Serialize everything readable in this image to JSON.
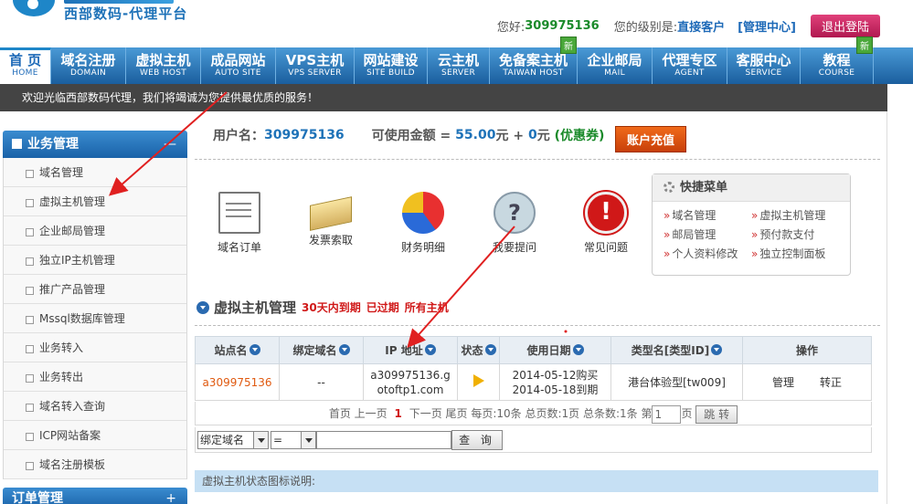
{
  "header": {
    "logo_text": "西部数码-代理平台",
    "greeting_label": "您好:",
    "user_id": "309975136",
    "level_label": "您的级别是:",
    "level_value": "直接客户",
    "manage_link": "[管理中心]",
    "logout_label": "退出登陆"
  },
  "nav": {
    "items": [
      {
        "cn": "首 页",
        "en": "HOME"
      },
      {
        "cn": "域名注册",
        "en": "DOMAIN"
      },
      {
        "cn": "虚拟主机",
        "en": "WEB HOST"
      },
      {
        "cn": "成品网站",
        "en": "AUTO SITE"
      },
      {
        "cn": "VPS主机",
        "en": "VPS SERVER"
      },
      {
        "cn": "网站建设",
        "en": "SITE BUILD"
      },
      {
        "cn": "云主机",
        "en": "SERVER"
      },
      {
        "cn": "免备案主机",
        "en": "TAIWAN HOST"
      },
      {
        "cn": "企业邮局",
        "en": "MAIL"
      },
      {
        "cn": "代理专区",
        "en": "AGENT"
      },
      {
        "cn": "客服中心",
        "en": "SERVICE"
      },
      {
        "cn": "教程",
        "en": "COURSE"
      }
    ],
    "new_badge": "新"
  },
  "welcome": "欢迎光临西部数码代理，我们将竭诚为您提供最优质的服务！",
  "sidebar": {
    "section_title": "业务管理",
    "section_toggle": "—",
    "items": [
      {
        "label": "域名管理"
      },
      {
        "label": "虚拟主机管理"
      },
      {
        "label": "企业邮局管理"
      },
      {
        "label": "独立IP主机管理"
      },
      {
        "label": "推广产品管理"
      },
      {
        "label": "Mssql数据库管理"
      },
      {
        "label": "业务转入"
      },
      {
        "label": "业务转出"
      },
      {
        "label": "域名转入查询"
      },
      {
        "label": "ICP网站备案"
      },
      {
        "label": "域名注册模板"
      }
    ],
    "section2_title": "订单管理",
    "section2_toggle": "+"
  },
  "account": {
    "username_label": "用户名：",
    "username": "309975136",
    "balance_label": "可使用金额 =",
    "balance": "55.00",
    "unit1": "元 +",
    "coupon_amount": "0",
    "unit2": "元",
    "coupon_label": "(优惠券)",
    "recharge_label": "账户充值"
  },
  "quick_icons": [
    {
      "label": "域名订单",
      "icon": "order-icon"
    },
    {
      "label": "发票索取",
      "icon": "invoice-icon"
    },
    {
      "label": "财务明细",
      "icon": "finance-icon"
    },
    {
      "label": "我要提问",
      "icon": "question-icon"
    },
    {
      "label": "常见问题",
      "icon": "faq-icon"
    }
  ],
  "quick_menu": {
    "title": "快捷菜单",
    "items": [
      {
        "label": "域名管理"
      },
      {
        "label": "虚拟主机管理"
      },
      {
        "label": "邮局管理"
      },
      {
        "label": "预付款支付"
      },
      {
        "label": "个人资料修改"
      },
      {
        "label": "独立控制面板"
      }
    ]
  },
  "section": {
    "title": "虚拟主机管理",
    "filter1": "30天内到期",
    "filter2": "已过期",
    "filter3": "所有主机"
  },
  "table": {
    "headers": [
      "站点名",
      "绑定域名",
      "IP 地址",
      "状态",
      "使用日期",
      "类型名[类型ID]",
      "操作"
    ],
    "rows": [
      {
        "site": "a309975136",
        "domain": "--",
        "ip": "a309975136.gotoftp1.com",
        "date_start": "2014-05-12购买",
        "date_end": "2014-05-18到期",
        "type": "港台体验型[tw009]",
        "op_manage": "管理",
        "op_convert": "转正"
      }
    ]
  },
  "pager": {
    "text_before": "首页 上一页",
    "current": "1",
    "text_after": "下一页 尾页 每页:10条 总页数:1页 总条数:1条 第",
    "jump_value": "1",
    "page_suffix": "页",
    "jump_label": "跳 转"
  },
  "filter": {
    "field_value": "绑定域名",
    "op_value": "=",
    "query_label": "查 询"
  },
  "status_note": "虚拟主机状态图标说明:",
  "colors": {
    "nav_blue": "#1a5e9e",
    "accent_red": "#d01818",
    "link_orange": "#e05a10",
    "price_blue": "#1e72b8"
  }
}
